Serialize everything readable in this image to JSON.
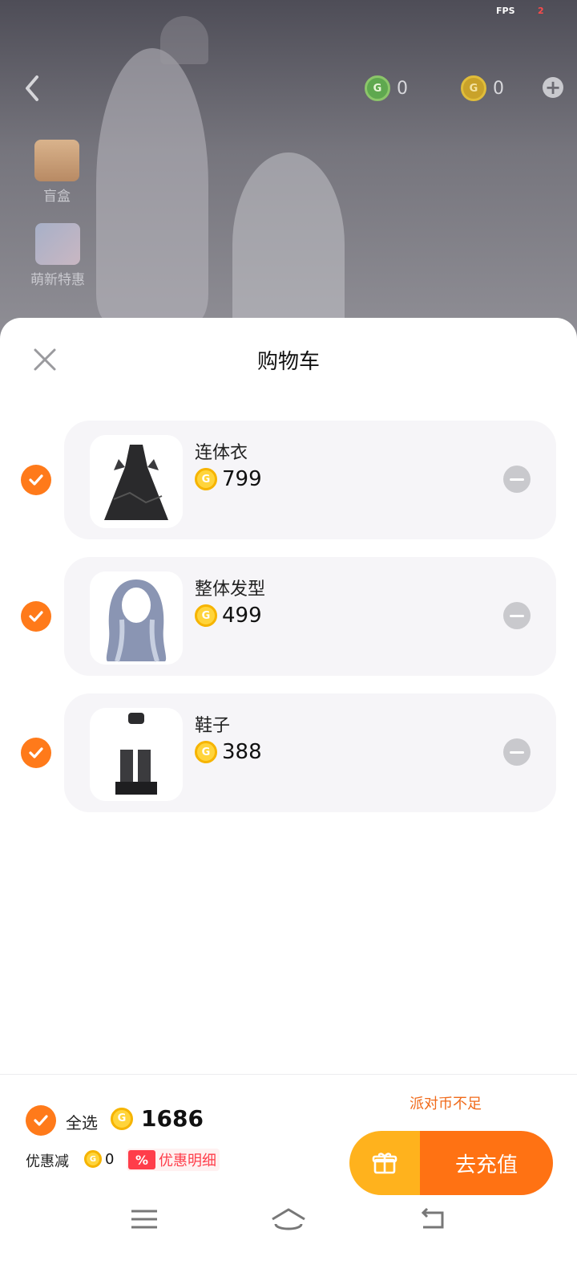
{
  "status": {
    "fps_label": "FPS",
    "fps_value": "2"
  },
  "header": {
    "gold_balance": "0",
    "party_balance": "0",
    "side_items": [
      {
        "label": "盲盒",
        "icon": "gift-box-icon"
      },
      {
        "label": "萌新特惠",
        "icon": "avatar-bundle-icon"
      }
    ]
  },
  "cart": {
    "title": "购物车",
    "items": [
      {
        "name": "连体衣",
        "price": "799",
        "icon": "black-dress-icon"
      },
      {
        "name": "整体发型",
        "price": "499",
        "icon": "hairstyle-icon"
      },
      {
        "name": "鞋子",
        "price": "388",
        "icon": "black-boots-icon"
      }
    ]
  },
  "footer": {
    "insufficient_text": "派对币不足",
    "select_all_label": "全选",
    "total": "1686",
    "discount_label": "优惠减",
    "discount_value": "0",
    "discount_badge": "%",
    "discount_detail": "优惠明细",
    "recharge_label": "去充值"
  },
  "colors": {
    "accent": "#ff7213",
    "check": "#ff7a1a",
    "gift_button": "#ffb21d",
    "coin": "#ffd43b",
    "warning": "#f06a1a",
    "discount": "#ff3d4a"
  }
}
